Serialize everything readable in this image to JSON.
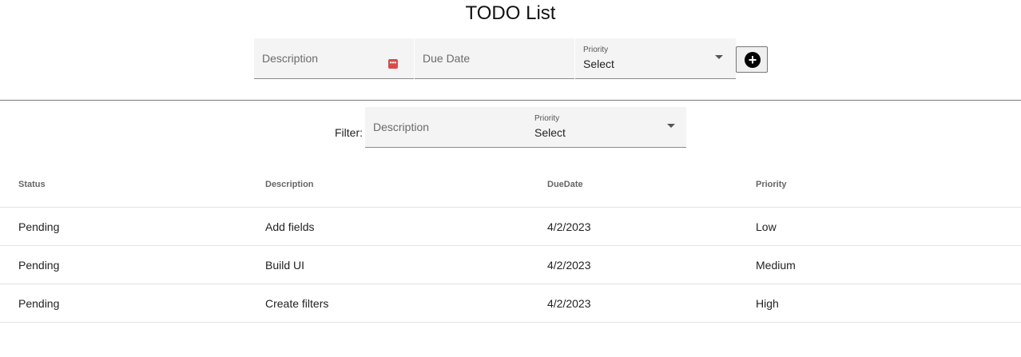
{
  "app": {
    "title": "TODO List"
  },
  "add_form": {
    "description_placeholder": "Description",
    "due_date_placeholder": "Due Date",
    "priority_label": "Priority",
    "priority_value": "Select"
  },
  "filter": {
    "label": "Filter:",
    "description_placeholder": "Description",
    "priority_label": "Priority",
    "priority_value": "Select"
  },
  "table": {
    "headers": [
      "Status",
      "Description",
      "DueDate",
      "Priority"
    ],
    "rows": [
      [
        "Pending",
        "Add fields",
        "4/2/2023",
        "Low"
      ],
      [
        "Pending",
        "Build UI",
        "4/2/2023",
        "Medium"
      ],
      [
        "Pending",
        "Create filters",
        "4/2/2023",
        "High"
      ]
    ]
  },
  "icons": {
    "add": "plus-circle-icon",
    "field_warning": "ellipsis-badge-icon",
    "dropdown": "caret-down-icon"
  },
  "colors": {
    "warning_badge": "#d94b4b"
  }
}
